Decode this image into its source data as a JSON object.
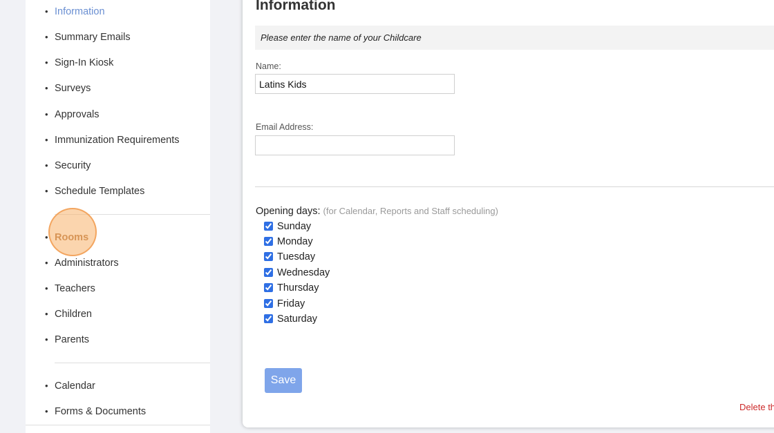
{
  "sidebar": {
    "items": [
      {
        "label": "Information",
        "state": "active"
      },
      {
        "label": "Summary Emails"
      },
      {
        "label": "Sign-In Kiosk"
      },
      {
        "label": "Surveys"
      },
      {
        "label": "Approvals"
      },
      {
        "label": "Immunization Requirements"
      },
      {
        "label": "Security"
      },
      {
        "label": "Schedule Templates"
      },
      {
        "label": "Rooms",
        "state": "highlighted"
      },
      {
        "label": "Administrators"
      },
      {
        "label": "Teachers"
      },
      {
        "label": "Children"
      },
      {
        "label": "Parents"
      },
      {
        "label": "Calendar"
      },
      {
        "label": "Forms & Documents"
      }
    ],
    "bullet": "•"
  },
  "main": {
    "title": "Information",
    "banner": "Please enter the name of your Childcare",
    "name_label": "Name:",
    "name_value": "Latins Kids",
    "email_label": "Email Address:",
    "email_value": "",
    "opening_days_label": "Opening days:",
    "opening_days_note": "(for Calendar, Reports and Staff scheduling)",
    "days": [
      {
        "label": "Sunday",
        "checked": true
      },
      {
        "label": "Monday",
        "checked": true
      },
      {
        "label": "Tuesday",
        "checked": true
      },
      {
        "label": "Wednesday",
        "checked": true
      },
      {
        "label": "Thursday",
        "checked": true
      },
      {
        "label": "Friday",
        "checked": true
      },
      {
        "label": "Saturday",
        "checked": true
      }
    ],
    "save_label": "Save",
    "delete_label": "Delete th"
  },
  "colors": {
    "active_link": "#6a8fd2",
    "highlight": "#f7b26c",
    "save_button": "#7fa5ea",
    "delete_link": "#cc2a2a"
  }
}
